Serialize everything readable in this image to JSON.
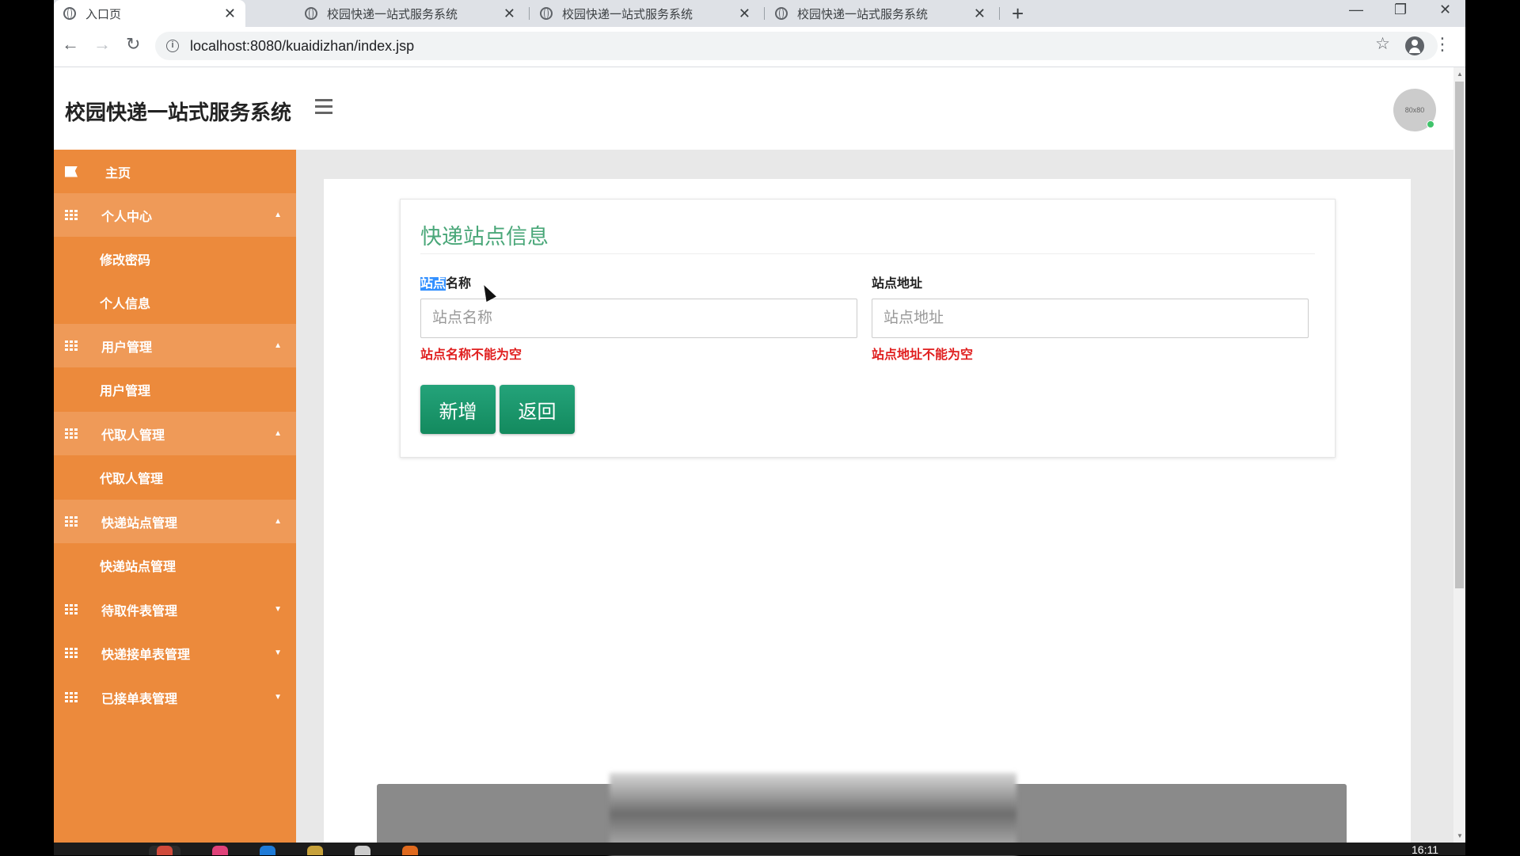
{
  "browser": {
    "tabs": [
      {
        "label": "入口页",
        "active": true
      },
      {
        "label": "校园快递一站式服务系统",
        "active": false
      },
      {
        "label": "校园快递一站式服务系统",
        "active": false
      },
      {
        "label": "校园快递一站式服务系统",
        "active": false
      }
    ],
    "url": "localhost:8080/kuaidizhan/index.jsp"
  },
  "header": {
    "title": "校园快递一站式服务系统",
    "avatar_text": "80x80"
  },
  "sidebar": {
    "items": [
      {
        "label": "主页",
        "type": "top",
        "icon": "flag-icon"
      },
      {
        "label": "个人中心",
        "type": "group",
        "icon": "grid-icon",
        "caret": "up"
      },
      {
        "label": "修改密码",
        "type": "sub"
      },
      {
        "label": "个人信息",
        "type": "sub"
      },
      {
        "label": "用户管理",
        "type": "group",
        "icon": "grid-icon",
        "caret": "up"
      },
      {
        "label": "用户管理",
        "type": "sub"
      },
      {
        "label": "代取人管理",
        "type": "group",
        "icon": "grid-icon",
        "caret": "up"
      },
      {
        "label": "代取人管理",
        "type": "sub"
      },
      {
        "label": "快递站点管理",
        "type": "group",
        "icon": "grid-icon",
        "caret": "up"
      },
      {
        "label": "快递站点管理",
        "type": "sub"
      },
      {
        "label": "待取件表管理",
        "type": "top",
        "icon": "grid-icon",
        "caret": "down"
      },
      {
        "label": "快递接单表管理",
        "type": "top",
        "icon": "grid-icon",
        "caret": "down"
      },
      {
        "label": "已接单表管理",
        "type": "top",
        "icon": "grid-icon",
        "caret": "down"
      }
    ]
  },
  "form": {
    "title": "快递站点信息",
    "name_label_selected": "站点",
    "name_label_rest": "名称",
    "name_placeholder": "站点名称",
    "name_error": "站点名称不能为空",
    "address_label": "站点地址",
    "address_placeholder": "站点地址",
    "address_error": "站点地址不能为空",
    "submit_label": "新增",
    "back_label": "返回"
  },
  "taskbar": {
    "clock": "16:11"
  },
  "colors": {
    "sidebar": "#ec8a3c",
    "sidebar_group": "#ef9a58",
    "title_green": "#4aa779",
    "button_green": "#1a9a6c",
    "error_red": "#e01f1f"
  }
}
